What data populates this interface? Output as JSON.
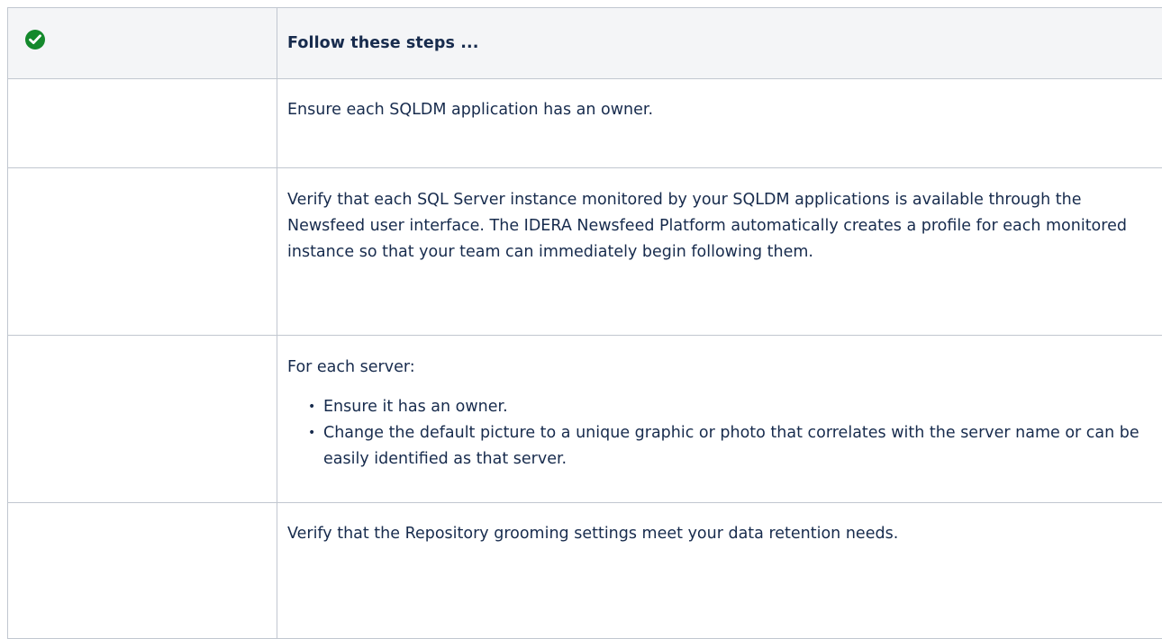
{
  "table": {
    "header": {
      "icon": "check-circle-icon",
      "icon_color": "#14892c",
      "title": "Follow these steps ..."
    },
    "rows": [
      {
        "text": "Ensure each SQLDM application has an owner."
      },
      {
        "text": "Verify that each SQL Server instance monitored by your SQLDM applications is available through the Newsfeed user interface. The IDERA Newsfeed Platform automatically creates a profile for each monitored instance so that your team can immediately begin following them."
      },
      {
        "intro": "For each server:",
        "bullets": [
          "Ensure it has an owner.",
          "Change the default picture to a unique graphic or photo that correlates with the server name or can be easily identified as that server."
        ]
      },
      {
        "text": "Verify that the Repository grooming settings meet your data retention needs."
      }
    ]
  }
}
